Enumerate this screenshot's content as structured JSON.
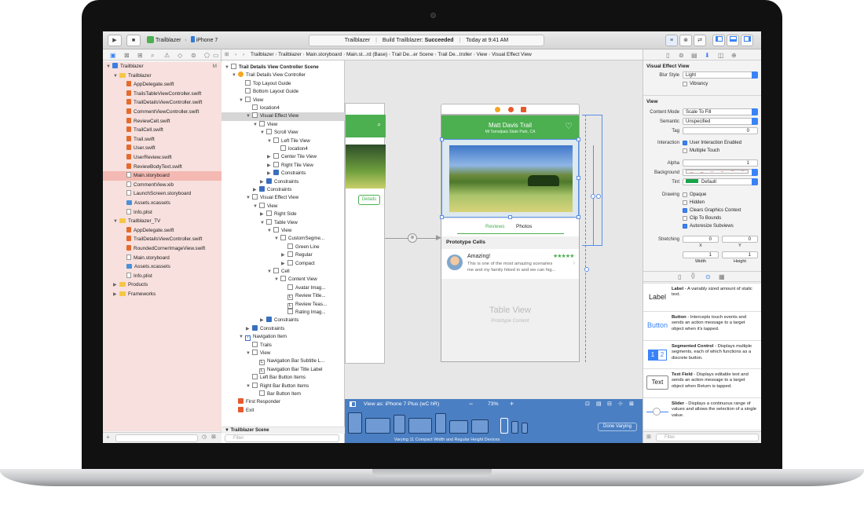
{
  "toolbar": {
    "scheme_app": "Trailblazer",
    "scheme_device": "iPhone 7",
    "status_project": "Trailblazer",
    "status_build_prefix": "Build Trailblazer:",
    "status_build_result": "Succeeded",
    "status_time": "Today at 9:41 AM"
  },
  "navigator": {
    "items": [
      {
        "label": "Trailblazer",
        "type": "proj",
        "indent": 0,
        "tri": "▼",
        "badge": "M",
        "sel": false
      },
      {
        "label": "Trailblazer",
        "type": "folder",
        "indent": 1,
        "tri": "▼",
        "sel": false
      },
      {
        "label": "AppDelegate.swift",
        "type": "file",
        "indent": 2,
        "sel": false
      },
      {
        "label": "TrailsTableViewController.swift",
        "type": "file",
        "indent": 2,
        "sel": false
      },
      {
        "label": "TrailDetailsViewController.swift",
        "type": "file",
        "indent": 2,
        "sel": false
      },
      {
        "label": "CommentViewController.swift",
        "type": "file",
        "indent": 2,
        "sel": false
      },
      {
        "label": "ReviewCell.swift",
        "type": "file",
        "indent": 2,
        "sel": false
      },
      {
        "label": "TrailCell.swift",
        "type": "file",
        "indent": 2,
        "sel": false
      },
      {
        "label": "Trail.swift",
        "type": "file",
        "indent": 2,
        "sel": false
      },
      {
        "label": "User.swift",
        "type": "file",
        "indent": 2,
        "sel": false
      },
      {
        "label": "UserReview.swift",
        "type": "file",
        "indent": 2,
        "sel": false
      },
      {
        "label": "ReviewBodyText.swift",
        "type": "file",
        "indent": 2,
        "sel": false
      },
      {
        "label": "Main.storyboard",
        "type": "sb",
        "indent": 2,
        "sel": true
      },
      {
        "label": "CommentView.xib",
        "type": "sb",
        "indent": 2,
        "sel": false
      },
      {
        "label": "LaunchScreen.storyboard",
        "type": "sb",
        "indent": 2,
        "sel": false
      },
      {
        "label": "Assets.xcassets",
        "type": "asset",
        "indent": 2,
        "sel": false
      },
      {
        "label": "Info.plist",
        "type": "plist",
        "indent": 2,
        "sel": false
      },
      {
        "label": "Trailblazer_TV",
        "type": "folder",
        "indent": 1,
        "tri": "▼",
        "sel": false
      },
      {
        "label": "AppDelegate.swift",
        "type": "file",
        "indent": 2,
        "sel": false
      },
      {
        "label": "TrailDetailsViewController.swift",
        "type": "file",
        "indent": 2,
        "sel": false
      },
      {
        "label": "RoundedCornerImageView.swift",
        "type": "file",
        "indent": 2,
        "sel": false
      },
      {
        "label": "Main.storyboard",
        "type": "sb",
        "indent": 2,
        "sel": false
      },
      {
        "label": "Assets.xcassets",
        "type": "asset",
        "indent": 2,
        "sel": false
      },
      {
        "label": "Info.plist",
        "type": "plist",
        "indent": 2,
        "sel": false
      },
      {
        "label": "Products",
        "type": "folder",
        "indent": 1,
        "tri": "▶",
        "sel": false
      },
      {
        "label": "Frameworks",
        "type": "folder",
        "indent": 1,
        "tri": "▶",
        "sel": false
      }
    ],
    "filter_placeholder": ""
  },
  "jumpbar": [
    "Trailblazer",
    "Trailblazer",
    "Main.storyboard",
    "Main.st...rd (Base)",
    "Trail De...er Scene",
    "Trail De...troller",
    "View",
    "Visual Effect View"
  ],
  "outline": {
    "rows": [
      {
        "label": "Trail Details View Controller Scene",
        "indent": 0,
        "tri": "▼",
        "bold": true
      },
      {
        "label": "Trail Details View Controller",
        "indent": 1,
        "tri": "▼",
        "icon": "vc"
      },
      {
        "label": "Top Layout Guide",
        "indent": 2
      },
      {
        "label": "Bottom Layout Guide",
        "indent": 2
      },
      {
        "label": "View",
        "indent": 2,
        "tri": "▼"
      },
      {
        "label": "location4",
        "indent": 3
      },
      {
        "label": "Visual Effect View",
        "indent": 3,
        "tri": "▼",
        "sel": true
      },
      {
        "label": "View",
        "indent": 4,
        "tri": "▼"
      },
      {
        "label": "Scroll View",
        "indent": 5,
        "tri": "▼"
      },
      {
        "label": "Left Tile View",
        "indent": 6,
        "tri": "▼"
      },
      {
        "label": "location4",
        "indent": 7
      },
      {
        "label": "Center Tile View",
        "indent": 6,
        "tri": "▶"
      },
      {
        "label": "Right Tile View",
        "indent": 6,
        "tri": "▶"
      },
      {
        "label": "Constraints",
        "indent": 6,
        "tri": "▶",
        "icon": "con"
      },
      {
        "label": "Constraints",
        "indent": 5,
        "tri": "▶",
        "icon": "con"
      },
      {
        "label": "Constraints",
        "indent": 4,
        "tri": "▶",
        "icon": "con"
      },
      {
        "label": "Visual Effect View",
        "indent": 3,
        "tri": "▼"
      },
      {
        "label": "View",
        "indent": 4,
        "tri": "▼"
      },
      {
        "label": "Right Side",
        "indent": 5,
        "tri": "▶"
      },
      {
        "label": "Table View",
        "indent": 5,
        "tri": "▼"
      },
      {
        "label": "View",
        "indent": 6,
        "tri": "▼"
      },
      {
        "label": "CustomSegme...",
        "indent": 7,
        "tri": "▼"
      },
      {
        "label": "Green Line",
        "indent": 8
      },
      {
        "label": "Regular",
        "indent": 8,
        "tri": "▶"
      },
      {
        "label": "Compact",
        "indent": 8,
        "tri": "▶"
      },
      {
        "label": "Cell",
        "indent": 6,
        "tri": "▼"
      },
      {
        "label": "Content View",
        "indent": 7,
        "tri": "▼"
      },
      {
        "label": "Avatar Imag...",
        "indent": 8
      },
      {
        "label": "Review Title...",
        "indent": 8,
        "L": true
      },
      {
        "label": "Review Teas...",
        "indent": 8,
        "L": true
      },
      {
        "label": "Rating Imag...",
        "indent": 8
      },
      {
        "label": "Constraints",
        "indent": 5,
        "tri": "▶",
        "icon": "con"
      },
      {
        "label": "Constraints",
        "indent": 3,
        "tri": "▶",
        "icon": "con"
      },
      {
        "label": "Navigation Item",
        "indent": 2,
        "tri": "▼",
        "icon": "nav"
      },
      {
        "label": "Trails",
        "indent": 3
      },
      {
        "label": "View",
        "indent": 3,
        "tri": "▼"
      },
      {
        "label": "Navigation Bar Subtitle L...",
        "indent": 4,
        "L": true
      },
      {
        "label": "Navigation Bar Title Label",
        "indent": 4,
        "L": true
      },
      {
        "label": "Left Bar Button Items",
        "indent": 3
      },
      {
        "label": "Right Bar Button Items",
        "indent": 3,
        "tri": "▼"
      },
      {
        "label": "Bar Button Item",
        "indent": 4
      },
      {
        "label": "First Responder",
        "indent": 1,
        "icon": "fr"
      },
      {
        "label": "Exit",
        "indent": 1,
        "icon": "exit"
      }
    ],
    "bottom_scene": "Trailblazer Scene",
    "filter_placeholder": "Filter"
  },
  "canvas": {
    "nav_title": "Matt Davis Trail",
    "nav_subtitle": "Mt Tamalpais State Park, CA",
    "tab_reviews": "Reviews",
    "tab_photos": "Photos",
    "section_header": "Prototype Cells",
    "review_title": "Amazing!",
    "review_stars": "★★★★★",
    "review_text_1": "This is one of the most amazing scenaries",
    "review_text_2": "me and my family hiked in and we can hig...",
    "table_placeholder": "Table View",
    "table_placeholder_sub": "Prototype Content",
    "left_details_btn": "Details"
  },
  "adaptive": {
    "view_as": "View as: iPhone 7 Plus (wC hR)",
    "zoom": "73%",
    "done_button": "Done Varying",
    "caption": "Varying 11 Compact Width and Regular Height Devices"
  },
  "inspector": {
    "section_vev": "Visual Effect View",
    "blur_label": "Blur Style",
    "blur_value": "Light",
    "vibrancy": "Vibrancy",
    "section_view": "View",
    "content_mode_label": "Content Mode",
    "content_mode_value": "Scale To Fill",
    "semantic_label": "Semantic",
    "semantic_value": "Unspecified",
    "tag_label": "Tag",
    "tag_value": "0",
    "interaction_label": "Interaction",
    "user_interaction": "User Interaction Enabled",
    "multiple_touch": "Multiple Touch",
    "alpha_label": "Alpha",
    "alpha_value": "1",
    "background_label": "Background",
    "tint_label": "Tint",
    "tint_value": "Default",
    "drawing_label": "Drawing",
    "opaque": "Opaque",
    "hidden": "Hidden",
    "clears_graphics": "Clears Graphics Context",
    "clip_bounds": "Clip To Bounds",
    "autoresize": "Autoresize Subviews",
    "stretching_label": "Stretching",
    "stretch_x_val": "0",
    "stretch_y_val": "0",
    "stretch_w_val": "1",
    "stretch_h_val": "1",
    "x_label": "X",
    "y_label": "Y",
    "width_label": "Width",
    "height_label": "Height"
  },
  "library": [
    {
      "icon": "Label",
      "title": "Label",
      "desc": " - A variably sized amount of static text."
    },
    {
      "icon": "Button",
      "title": "Button",
      "desc": " - Intercepts touch events and sends an action message to a target object when it's tapped."
    },
    {
      "icon": "seg",
      "title": "Segmented Control",
      "desc": " - Displays multiple segments, each of which functions as a discrete button."
    },
    {
      "icon": "Text",
      "title": "Text Field",
      "desc": " - Displays editable text and sends an action message to a target object when Return is tapped."
    },
    {
      "icon": "slider",
      "title": "Slider",
      "desc": " - Displays a continuous range of values and allows the selection of a single value."
    }
  ],
  "library_filter": "Filter",
  "colors": {
    "accent": "#3a82f7",
    "green": "#4caf50",
    "stars": "#4caf50"
  }
}
